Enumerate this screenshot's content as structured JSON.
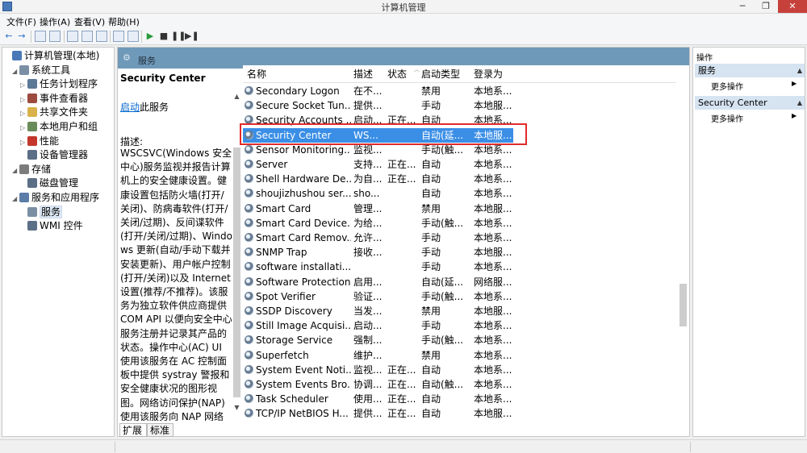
{
  "window": {
    "title": "计算机管理",
    "min_glyph": "─",
    "max_glyph": "❐",
    "close_glyph": "✕"
  },
  "menu": [
    "文件(F)",
    "操作(A)",
    "查看(V)",
    "帮助(H)"
  ],
  "toolbar": {
    "back": "←",
    "forward": "→",
    "start_glyph": "▶",
    "stop_glyph": "■",
    "pause_glyph": "❚❚",
    "restart_glyph": "▶❚"
  },
  "tree": [
    {
      "label": "计算机管理(本地)",
      "level": 0,
      "icon_color": "#4a79b8",
      "icon": "computer-icon"
    },
    {
      "label": "系统工具",
      "level": 1,
      "icon_color": "#7a8fa6",
      "icon": "tools-icon"
    },
    {
      "label": "任务计划程序",
      "level": 2,
      "icon_color": "#5c7897",
      "icon": "clock-icon"
    },
    {
      "label": "事件查看器",
      "level": 2,
      "icon_color": "#9c4b3e",
      "icon": "event-viewer-icon"
    },
    {
      "label": "共享文件夹",
      "level": 2,
      "icon_color": "#d9b24b",
      "icon": "folder-icon"
    },
    {
      "label": "本地用户和组",
      "level": 2,
      "icon_color": "#6a8c5a",
      "icon": "users-icon"
    },
    {
      "label": "性能",
      "level": 2,
      "icon_color": "#c4372c",
      "icon": "performance-icon"
    },
    {
      "label": "设备管理器",
      "level": 2,
      "icon_color": "#5b6f86",
      "icon": "device-manager-icon"
    },
    {
      "label": "存储",
      "level": 1,
      "icon_color": "#7c7c7c",
      "icon": "storage-icon"
    },
    {
      "label": "磁盘管理",
      "level": 2,
      "icon_color": "#5b6f86",
      "icon": "disk-icon"
    },
    {
      "label": "服务和应用程序",
      "level": 1,
      "icon_color": "#5b7da8",
      "icon": "apps-icon"
    },
    {
      "label": "服务",
      "level": 2,
      "icon_color": "#7a8ea4",
      "icon": "services-icon",
      "selected": true
    },
    {
      "label": "WMI 控件",
      "level": 2,
      "icon_color": "#5b6f86",
      "icon": "wmi-icon"
    }
  ],
  "center": {
    "header": "服务",
    "header_icon": "⚙",
    "desc": {
      "service_name": "Security Center",
      "start_link": "启动",
      "start_suffix": "此服务",
      "desc_label": "描述:",
      "desc_text": "WSCSVC(Windows 安全中心)服务监视并报告计算机上的安全健康设置。健康设置包括防火墙(打开/关闭)、防病毒软件(打开/关闭/过期)、反间谍软件(打开/关闭/过期)、Windows 更新(自动/手动下载并安装更新)、用户帐户控制(打开/关闭)以及 Internet 设置(推荐/不推荐)。该服务为独立软件供应商提供 COM API 以便向安全中心服务注册并记录其产品的状态。操作中心(AC) UI 使用该服务在 AC 控制面板中提供 systray 警报和安全健康状况的图形视图。网络访问保护(NAP)使用该服务向 NAP 网络策略服务器报告客户端的安全健康状况，"
    },
    "columns": {
      "name": "名称",
      "desc": "描述",
      "status": "状态",
      "startup": "启动类型",
      "logon": "登录为"
    },
    "services": [
      {
        "name": "Secondary Logon",
        "desc": "在不...",
        "status": "",
        "startup": "禁用",
        "logon": "本地系..."
      },
      {
        "name": "Secure Socket Tun...",
        "desc": "提供...",
        "status": "",
        "startup": "手动",
        "logon": "本地服..."
      },
      {
        "name": "Security Accounts ...",
        "desc": "启动...",
        "status": "正在...",
        "startup": "自动",
        "logon": "本地系..."
      },
      {
        "name": "Security Center",
        "desc": "WS...",
        "status": "",
        "startup": "自动(延...",
        "logon": "本地服...",
        "selected": true
      },
      {
        "name": "Sensor Monitoring...",
        "desc": "监视...",
        "status": "",
        "startup": "手动(触...",
        "logon": "本地系..."
      },
      {
        "name": "Server",
        "desc": "支持...",
        "status": "正在...",
        "startup": "自动",
        "logon": "本地系..."
      },
      {
        "name": "Shell Hardware De...",
        "desc": "为自...",
        "status": "正在...",
        "startup": "自动",
        "logon": "本地系..."
      },
      {
        "name": "shoujizhushou ser...",
        "desc": "sho...",
        "status": "",
        "startup": "自动",
        "logon": "本地系..."
      },
      {
        "name": "Smart Card",
        "desc": "管理...",
        "status": "",
        "startup": "禁用",
        "logon": "本地服..."
      },
      {
        "name": "Smart Card Device...",
        "desc": "为给...",
        "status": "",
        "startup": "手动(触...",
        "logon": "本地系..."
      },
      {
        "name": "Smart Card Remov...",
        "desc": "允许...",
        "status": "",
        "startup": "手动",
        "logon": "本地系..."
      },
      {
        "name": "SNMP Trap",
        "desc": "接收...",
        "status": "",
        "startup": "手动",
        "logon": "本地服..."
      },
      {
        "name": "software installati...",
        "desc": "",
        "status": "",
        "startup": "手动",
        "logon": "本地系..."
      },
      {
        "name": "Software Protection",
        "desc": "启用...",
        "status": "",
        "startup": "自动(延...",
        "logon": "网络服..."
      },
      {
        "name": "Spot Verifier",
        "desc": "验证...",
        "status": "",
        "startup": "手动(触...",
        "logon": "本地系..."
      },
      {
        "name": "SSDP Discovery",
        "desc": "当发...",
        "status": "",
        "startup": "禁用",
        "logon": "本地服..."
      },
      {
        "name": "Still Image Acquisi...",
        "desc": "启动...",
        "status": "",
        "startup": "手动",
        "logon": "本地系..."
      },
      {
        "name": "Storage Service",
        "desc": "强制...",
        "status": "",
        "startup": "手动(触...",
        "logon": "本地系..."
      },
      {
        "name": "Superfetch",
        "desc": "维护...",
        "status": "",
        "startup": "禁用",
        "logon": "本地系..."
      },
      {
        "name": "System Event Noti...",
        "desc": "监视...",
        "status": "正在...",
        "startup": "自动",
        "logon": "本地系..."
      },
      {
        "name": "System Events Bro...",
        "desc": "协调...",
        "status": "正在...",
        "startup": "自动(触...",
        "logon": "本地系..."
      },
      {
        "name": "Task Scheduler",
        "desc": "使用...",
        "status": "正在...",
        "startup": "自动",
        "logon": "本地系..."
      },
      {
        "name": "TCP/IP NetBIOS H...",
        "desc": "提供...",
        "status": "正在...",
        "startup": "自动",
        "logon": "本地服..."
      }
    ],
    "tabs": {
      "expand": "扩展",
      "standard": "标准"
    }
  },
  "actions": {
    "title": "操作",
    "sections": [
      {
        "header": "服务",
        "item": "更多操作"
      },
      {
        "header": "Security Center",
        "item": "更多操作"
      }
    ]
  },
  "colors": {
    "accent": "#3a8ee6",
    "header_bar": "#6f99b9",
    "highlight_box": "#e02b2b"
  }
}
